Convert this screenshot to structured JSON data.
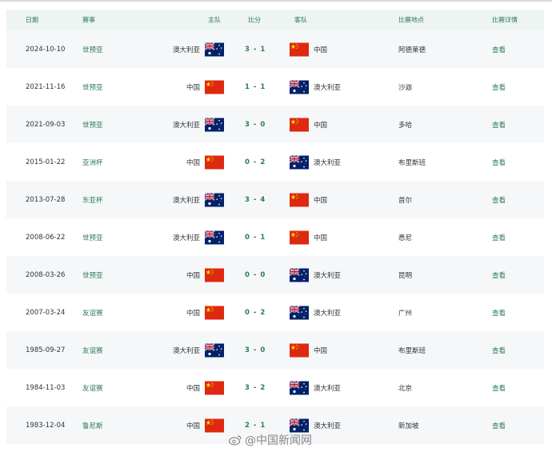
{
  "header": {
    "date": "日期",
    "competition": "赛事",
    "home": "主队",
    "score": "比分",
    "away": "客队",
    "venue": "比赛地点",
    "detail": "比赛详情"
  },
  "rows": [
    {
      "date": "2024-10-10",
      "competition": "世预亚",
      "home": "澳大利亚",
      "home_flag": "au",
      "score": "3 - 1",
      "away": "中国",
      "away_flag": "cn",
      "venue": "阿德莱德",
      "detail": "查看"
    },
    {
      "date": "2021-11-16",
      "competition": "世预亚",
      "home": "中国",
      "home_flag": "cn",
      "score": "1 - 1",
      "away": "澳大利亚",
      "away_flag": "au",
      "venue": "沙迦",
      "detail": "查看"
    },
    {
      "date": "2021-09-03",
      "competition": "世预亚",
      "home": "澳大利亚",
      "home_flag": "au",
      "score": "3 - 0",
      "away": "中国",
      "away_flag": "cn",
      "venue": "多哈",
      "detail": "查看"
    },
    {
      "date": "2015-01-22",
      "competition": "亚洲杯",
      "home": "中国",
      "home_flag": "cn",
      "score": "0 - 2",
      "away": "澳大利亚",
      "away_flag": "au",
      "venue": "布里斯班",
      "detail": "查看"
    },
    {
      "date": "2013-07-28",
      "competition": "东亚杯",
      "home": "澳大利亚",
      "home_flag": "au",
      "score": "3 - 4",
      "away": "中国",
      "away_flag": "cn",
      "venue": "首尔",
      "detail": "查看"
    },
    {
      "date": "2008-06-22",
      "competition": "世预亚",
      "home": "澳大利亚",
      "home_flag": "au",
      "score": "0 - 1",
      "away": "中国",
      "away_flag": "cn",
      "venue": "悉尼",
      "detail": "查看"
    },
    {
      "date": "2008-03-26",
      "competition": "世预亚",
      "home": "中国",
      "home_flag": "cn",
      "score": "0 - 0",
      "away": "澳大利亚",
      "away_flag": "au",
      "venue": "昆明",
      "detail": "查看"
    },
    {
      "date": "2007-03-24",
      "competition": "友谊赛",
      "home": "中国",
      "home_flag": "cn",
      "score": "0 - 2",
      "away": "澳大利亚",
      "away_flag": "au",
      "venue": "广州",
      "detail": "查看"
    },
    {
      "date": "1985-09-27",
      "competition": "友谊赛",
      "home": "澳大利亚",
      "home_flag": "au",
      "score": "3 - 0",
      "away": "中国",
      "away_flag": "cn",
      "venue": "布里斯班",
      "detail": "查看"
    },
    {
      "date": "1984-11-03",
      "competition": "友谊赛",
      "home": "中国",
      "home_flag": "cn",
      "score": "3 - 2",
      "away": "澳大利亚",
      "away_flag": "au",
      "venue": "北京",
      "detail": "查看"
    },
    {
      "date": "1983-12-04",
      "competition": "鲁尼斯",
      "home": "中国",
      "home_flag": "cn",
      "score": "2 - 1",
      "away": "澳大利亚",
      "away_flag": "au",
      "venue": "新加坡",
      "detail": "查看"
    }
  ],
  "watermark": "@中国新闻网",
  "colors": {
    "accent": "#2c7a57",
    "header_bg": "#eef4f1",
    "alt_row_bg": "#f5f7f9",
    "china_red": "#de2910",
    "china_yellow": "#ffde00",
    "au_blue": "#012169"
  }
}
